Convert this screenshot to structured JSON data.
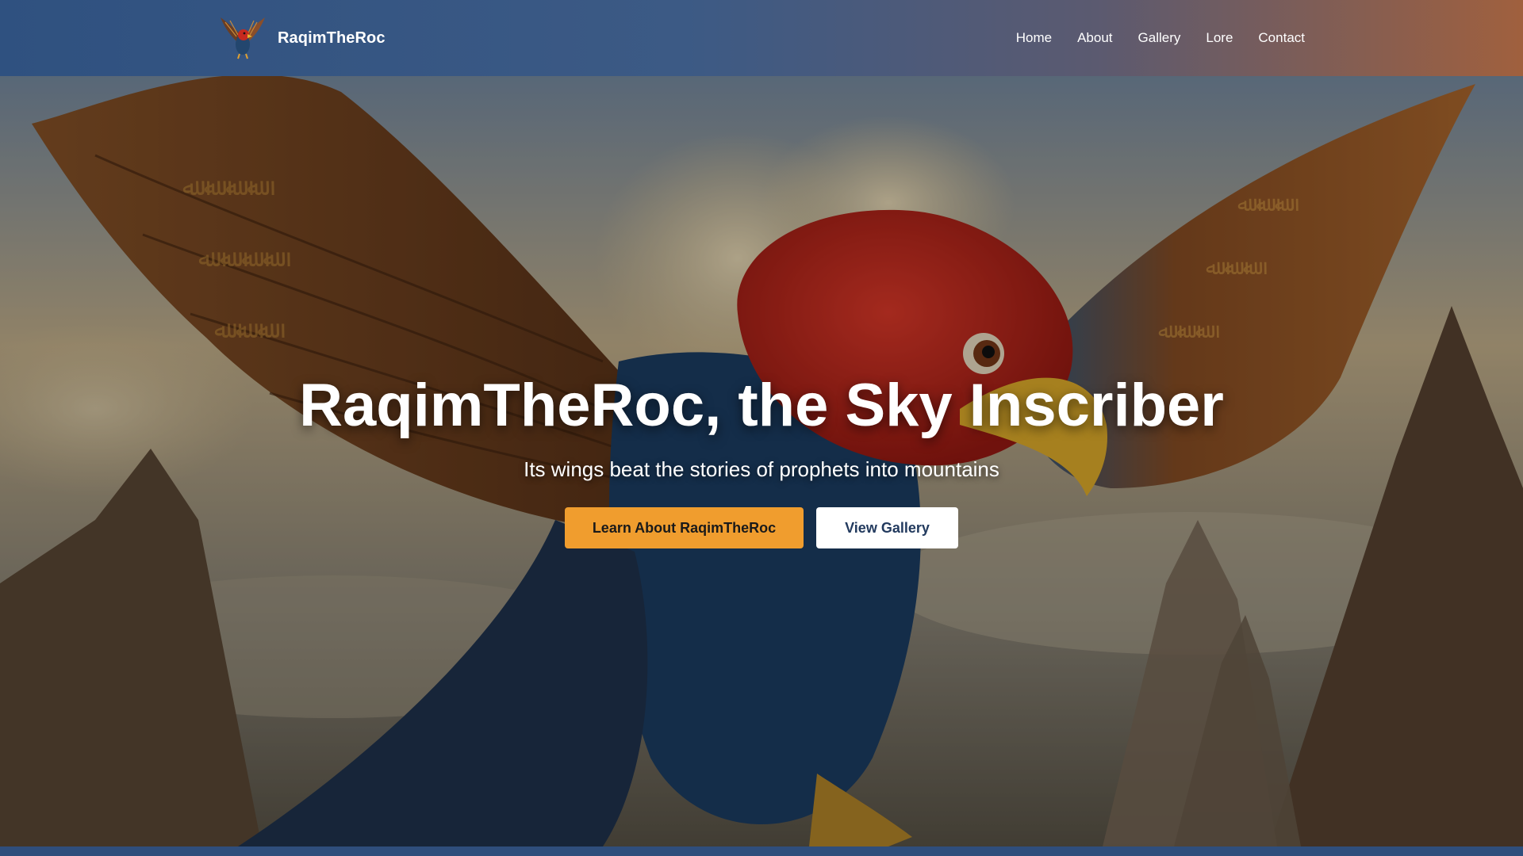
{
  "header": {
    "brand_name": "RaqimTheRoc",
    "logo_icon": "roc-bird-icon",
    "nav_items": [
      {
        "label": "Home"
      },
      {
        "label": "About"
      },
      {
        "label": "Gallery"
      },
      {
        "label": "Lore"
      },
      {
        "label": "Contact"
      }
    ]
  },
  "hero": {
    "title": "RaqimTheRoc, the Sky Inscriber",
    "subtitle": "Its wings beat the stories of prophets into mountains",
    "primary_button": "Learn About RaqimTheRoc",
    "secondary_button": "View Gallery"
  },
  "colors": {
    "header_gradient_start": "#2f5180",
    "header_gradient_end": "#a0603e",
    "primary_button": "#f09d2e",
    "secondary_button": "#ffffff",
    "footer_bar": "#2f4e7c"
  }
}
